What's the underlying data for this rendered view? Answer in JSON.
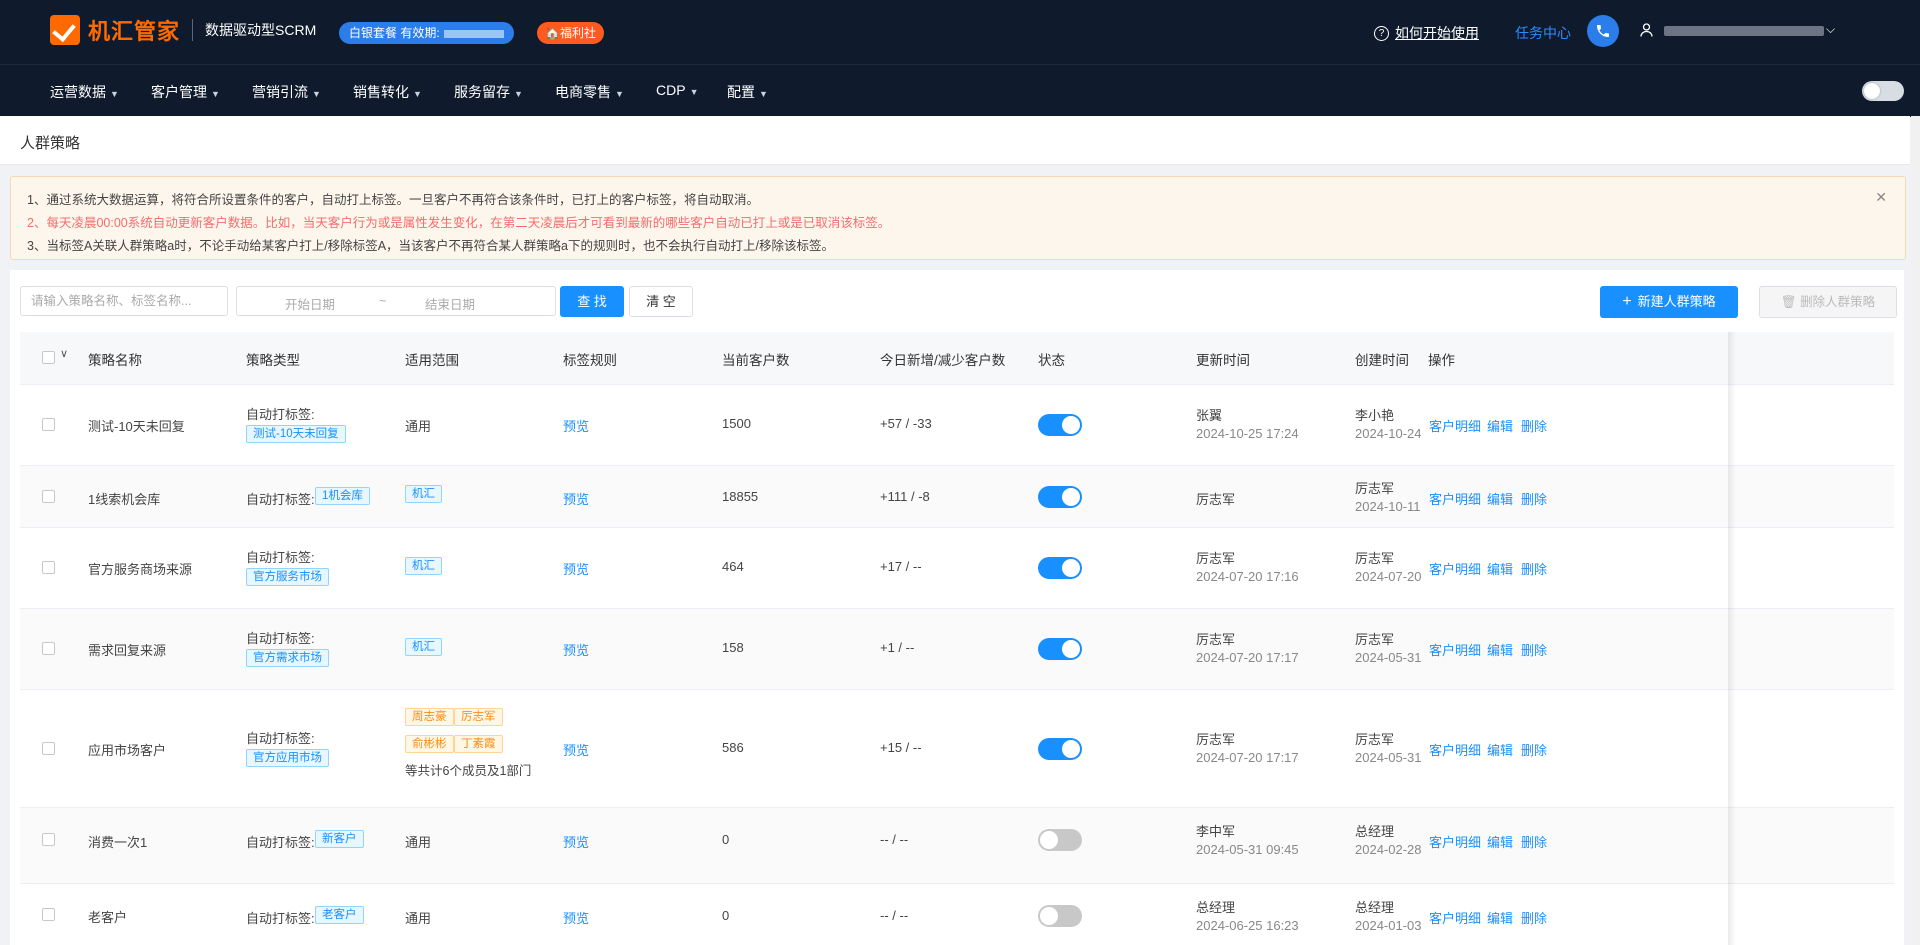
{
  "header": {
    "logo_text": "机汇管家",
    "subtitle": "数据驱动型SCRM",
    "package_badge": "白银套餐 有效期:",
    "welfare_badge": "🏠福利社",
    "help_link": "如何开始使用",
    "task_center": "任务中心"
  },
  "nav": {
    "items": [
      "运营数据",
      "客户管理",
      "营销引流",
      "销售转化",
      "服务留存",
      "电商零售",
      "CDP",
      "配置"
    ]
  },
  "page": {
    "title": "人群策略"
  },
  "notice": {
    "line1": "1、通过系统大数据运算，将符合所设置条件的客户，自动打上标签。一旦客户不再符合该条件时，已打上的客户标签，将自动取消。",
    "line2": "2、每天凌晨00:00系统自动更新客户数据。比如，当天客户行为或是属性发生变化，在第二天凌晨后才可看到最新的哪些客户自动已打上或是已取消该标签。",
    "line3": "3、当标签A关联人群策略a时，不论手动给某客户打上/移除标签A，当该客户不再符合某人群策略a下的规则时，也不会执行自动打上/移除该标签。"
  },
  "toolbar": {
    "search_placeholder": "请输入策略名称、标签名称...",
    "start_date": "开始日期",
    "range_sep": "~",
    "end_date": "结束日期",
    "query": "查 找",
    "clear": "清 空",
    "new_strategy": "新建人群策略",
    "delete_strategy": "删除人群策略"
  },
  "table": {
    "headers": [
      "策略名称",
      "策略类型",
      "适用范围",
      "标签规则",
      "当前客户数",
      "今日新增/减少客户数",
      "状态",
      "更新时间",
      "创建时间",
      "操作"
    ],
    "actions": [
      "客户明细",
      "编辑",
      "删除"
    ],
    "rows": [
      {
        "name": "测试-10天未回复",
        "type_label": "自动打标签:",
        "type_tag": "测试-10天未回复",
        "scope": "通用",
        "scope_tags": [],
        "scope_note": "",
        "rule": "预览",
        "count": "1500",
        "delta": "+57 / -33",
        "status": "on",
        "updated_by": "张翼",
        "updated_at": "2024-10-25 17:24",
        "created_by": "李小艳",
        "created_at": "2024-10-24"
      },
      {
        "name": "1线索机会库",
        "type_label": "自动打标签:",
        "type_tag": "1机会库",
        "scope": "",
        "scope_tags": [
          "机汇"
        ],
        "scope_note": "",
        "rule": "预览",
        "count": "18855",
        "delta": "+111 / -8",
        "status": "on",
        "updated_by": "厉志军",
        "updated_at": "",
        "created_by": "厉志军",
        "created_at": "2024-10-11"
      },
      {
        "name": "官方服务商场来源",
        "type_label": "自动打标签:",
        "type_tag": "官方服务市场",
        "scope": "",
        "scope_tags": [
          "机汇"
        ],
        "scope_note": "",
        "rule": "预览",
        "count": "464",
        "delta": "+17 / --",
        "status": "on",
        "updated_by": "厉志军",
        "updated_at": "2024-07-20 17:16",
        "created_by": "厉志军",
        "created_at": "2024-07-20"
      },
      {
        "name": "需求回复来源",
        "type_label": "自动打标签:",
        "type_tag": "官方需求市场",
        "scope": "",
        "scope_tags": [
          "机汇"
        ],
        "scope_note": "",
        "rule": "预览",
        "count": "158",
        "delta": "+1 / --",
        "status": "on",
        "updated_by": "厉志军",
        "updated_at": "2024-07-20 17:17",
        "created_by": "厉志军",
        "created_at": "2024-05-31"
      },
      {
        "name": "应用市场客户",
        "type_label": "自动打标签:",
        "type_tag": "官方应用市场",
        "scope": "",
        "scope_tags": [
          "周志豪",
          "厉志军",
          "俞彬彬",
          "丁素霞"
        ],
        "scope_note": "等共计6个成员及1部门",
        "rule": "预览",
        "count": "586",
        "delta": "+15 / --",
        "status": "on",
        "updated_by": "厉志军",
        "updated_at": "2024-07-20 17:17",
        "created_by": "厉志军",
        "created_at": "2024-05-31"
      },
      {
        "name": "消费一次1",
        "type_label": "自动打标签:",
        "type_tag": "新客户",
        "scope": "通用",
        "scope_tags": [],
        "scope_note": "",
        "rule": "预览",
        "count": "0",
        "delta": "-- / --",
        "status": "off",
        "updated_by": "李中军",
        "updated_at": "2024-05-31 09:45",
        "created_by": "总经理",
        "created_at": "2024-02-28"
      },
      {
        "name": "老客户",
        "type_label": "自动打标签:",
        "type_tag": "老客户",
        "scope": "通用",
        "scope_tags": [],
        "scope_note": "",
        "rule": "预览",
        "count": "0",
        "delta": "-- / --",
        "status": "off",
        "updated_by": "总经理",
        "updated_at": "2024-06-25 16:23",
        "created_by": "总经理",
        "created_at": "2024-01-03"
      }
    ]
  },
  "colors": {
    "topbar": "#0f1b2d",
    "brand_orange": "#ff6a00",
    "primary_blue": "#1890ff"
  }
}
